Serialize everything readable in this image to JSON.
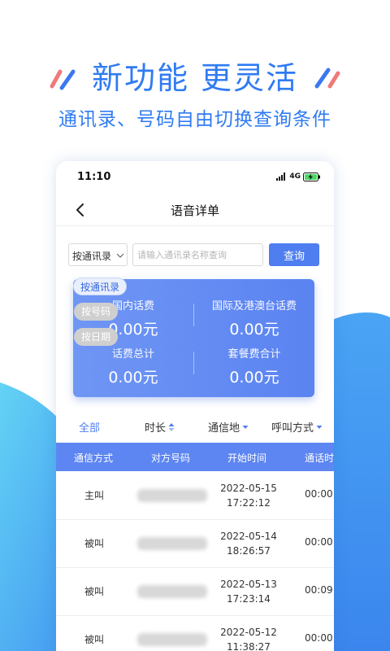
{
  "promo": {
    "headline": "新功能 更灵活",
    "subline": "通讯录、号码自由切换查询条件"
  },
  "colors": {
    "accent": "#2f7bf2",
    "button": "#4f7ef0",
    "table_header": "#5d86f2"
  },
  "status_bar": {
    "time": "11:10",
    "network": "4G",
    "icons": [
      "signal-icon",
      "battery-charging-icon"
    ]
  },
  "nav": {
    "title": "语音详单",
    "back_icon": "chevron-left-icon"
  },
  "filter": {
    "select_value": "按通讯录",
    "search_placeholder": "请输入通讯录名称查询",
    "query_label": "查询",
    "options": [
      "按通讯录",
      "按号码",
      "按日期"
    ]
  },
  "summary": {
    "items": [
      {
        "label": "国内话费",
        "value": "0.00元"
      },
      {
        "label": "国际及港澳台话费",
        "value": "0.00元"
      },
      {
        "label": "话费总计",
        "value": "0.00元"
      },
      {
        "label": "套餐费合计",
        "value": "0.00元"
      }
    ]
  },
  "tabs": [
    {
      "label": "全部",
      "icon": ""
    },
    {
      "label": "时长",
      "icon": "sort-icon"
    },
    {
      "label": "通信地",
      "icon": "caret-down-icon"
    },
    {
      "label": "呼叫方式",
      "icon": "caret-down-icon"
    }
  ],
  "table": {
    "columns": [
      "通信方式",
      "对方号码",
      "开始时间",
      "通话时"
    ],
    "rows": [
      {
        "type": "主叫",
        "date": "2022-05-15",
        "time": "17:22:12",
        "duration": "00:00"
      },
      {
        "type": "被叫",
        "date": "2022-05-14",
        "time": "18:26:57",
        "duration": "00:00"
      },
      {
        "type": "被叫",
        "date": "2022-05-13",
        "time": "17:23:14",
        "duration": "00:09"
      },
      {
        "type": "被叫",
        "date": "2022-05-12",
        "time": "11:38:27",
        "duration": "00:00"
      }
    ]
  }
}
